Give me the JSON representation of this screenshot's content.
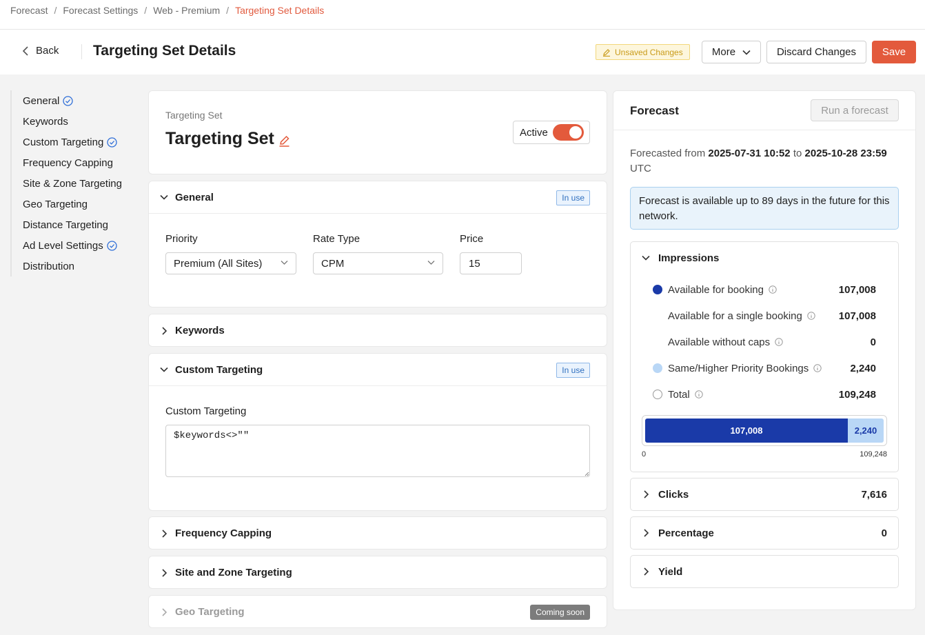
{
  "breadcrumb": [
    "Forecast",
    "Forecast Settings",
    "Web - Premium",
    "Targeting Set Details"
  ],
  "header": {
    "back_label": "Back",
    "title": "Targeting Set Details",
    "unsaved_label": "Unsaved Changes",
    "more_label": "More",
    "discard_label": "Discard Changes",
    "save_label": "Save"
  },
  "sidebar": {
    "items": [
      {
        "label": "General",
        "checked": true
      },
      {
        "label": "Keywords",
        "checked": false
      },
      {
        "label": "Custom Targeting",
        "checked": true
      },
      {
        "label": "Frequency Capping",
        "checked": false
      },
      {
        "label": "Site & Zone Targeting",
        "checked": false
      },
      {
        "label": "Geo Targeting",
        "checked": false
      },
      {
        "label": "Distance Targeting",
        "checked": false
      },
      {
        "label": "Ad Level Settings",
        "checked": true
      },
      {
        "label": "Distribution",
        "checked": false
      }
    ]
  },
  "targeting_set": {
    "eyebrow": "Targeting Set",
    "name": "Targeting Set",
    "active_label": "Active",
    "active": true
  },
  "sections": {
    "general": {
      "title": "General",
      "badge": "In use",
      "priority_label": "Priority",
      "priority_value": "Premium (All Sites)",
      "rate_type_label": "Rate Type",
      "rate_type_value": "CPM",
      "price_label": "Price",
      "price_value": "15"
    },
    "keywords": {
      "title": "Keywords"
    },
    "custom_targeting": {
      "title": "Custom Targeting",
      "badge": "In use",
      "field_label": "Custom Targeting",
      "field_value": "$keywords<>\"\""
    },
    "frequency_capping": {
      "title": "Frequency Capping"
    },
    "site_zone": {
      "title": "Site and Zone Targeting"
    },
    "geo": {
      "title": "Geo Targeting",
      "badge": "Coming soon"
    }
  },
  "forecast": {
    "title": "Forecast",
    "run_label": "Run a forecast",
    "range_prefix": "Forecasted from",
    "range_from": "2025-07-31 10:52",
    "range_mid": "to",
    "range_to": "2025-10-28 23:59",
    "range_tz": "UTC",
    "info": "Forecast is available up to 89 days in the future for this network.",
    "impressions": {
      "title": "Impressions",
      "rows": [
        {
          "label": "Available for booking",
          "value": "107,008",
          "dot": "#1a3aa8"
        },
        {
          "label": "Available for a single booking",
          "value": "107,008",
          "dot": ""
        },
        {
          "label": "Available without caps",
          "value": "0",
          "dot": ""
        },
        {
          "label": "Same/Higher Priority Bookings",
          "value": "2,240",
          "dot": "#b9d7f6"
        },
        {
          "label": "Total",
          "value": "109,248",
          "dot": "hollow"
        }
      ],
      "bar": {
        "available": 107008,
        "available_label": "107,008",
        "booked": 2240,
        "booked_label": "2,240",
        "axis_min": "0",
        "axis_max": "109,248"
      }
    },
    "clicks": {
      "title": "Clicks",
      "value": "7,616"
    },
    "percentage": {
      "title": "Percentage",
      "value": "0"
    },
    "yield": {
      "title": "Yield"
    }
  },
  "colors": {
    "accent": "#e35a3c",
    "primary_bar": "#1a3aa8",
    "secondary_bar": "#b9d7f6",
    "badge_blue": "#2f6fbf"
  }
}
